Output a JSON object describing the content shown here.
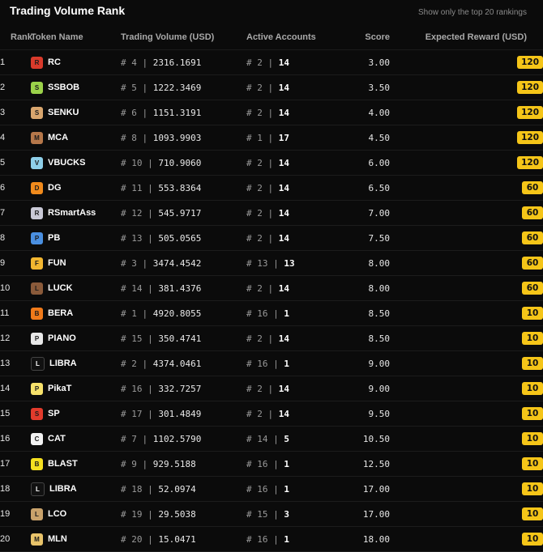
{
  "header": {
    "title": "Trading Volume Rank",
    "subtitle": "Show only the top 20 rankings"
  },
  "columns": {
    "rank": "Rank",
    "token": "Token Name",
    "volume": "Trading Volume (USD)",
    "accounts": "Active Accounts",
    "score": "Score",
    "reward": "Expected Reward (USD)"
  },
  "rows": [
    {
      "rank": "1",
      "token": "RC",
      "vol_rank": "4",
      "volume": "2316.1691",
      "acc_rank": "2",
      "accounts": "14",
      "score": "3.00",
      "reward": "120",
      "icon": "rc-icon",
      "icon_color": "#d93a2b",
      "icon_text": "R"
    },
    {
      "rank": "2",
      "token": "SSBOB",
      "vol_rank": "5",
      "volume": "1222.3469",
      "acc_rank": "2",
      "accounts": "14",
      "score": "3.50",
      "reward": "120",
      "icon": "ssbob-icon",
      "icon_color": "#9bd24a",
      "icon_text": "S"
    },
    {
      "rank": "3",
      "token": "SENKU",
      "vol_rank": "6",
      "volume": "1151.3191",
      "acc_rank": "2",
      "accounts": "14",
      "score": "4.00",
      "reward": "120",
      "icon": "senku-icon",
      "icon_color": "#d9a66e",
      "icon_text": "S"
    },
    {
      "rank": "4",
      "token": "MCA",
      "vol_rank": "8",
      "volume": "1093.9903",
      "acc_rank": "1",
      "accounts": "17",
      "score": "4.50",
      "reward": "120",
      "icon": "mca-icon",
      "icon_color": "#b5774a",
      "icon_text": "M"
    },
    {
      "rank": "5",
      "token": "VBUCKS",
      "vol_rank": "10",
      "volume": "710.9060",
      "acc_rank": "2",
      "accounts": "14",
      "score": "6.00",
      "reward": "120",
      "icon": "vbucks-icon",
      "icon_color": "#8fd0ea",
      "icon_text": "V"
    },
    {
      "rank": "6",
      "token": "DG",
      "vol_rank": "11",
      "volume": "553.8364",
      "acc_rank": "2",
      "accounts": "14",
      "score": "6.50",
      "reward": "60",
      "icon": "dg-icon",
      "icon_color": "#f08a1c",
      "icon_text": "D"
    },
    {
      "rank": "7",
      "token": "RSmartAss",
      "vol_rank": "12",
      "volume": "545.9717",
      "acc_rank": "2",
      "accounts": "14",
      "score": "7.00",
      "reward": "60",
      "icon": "rsmartass-icon",
      "icon_color": "#c9c9d6",
      "icon_text": "R"
    },
    {
      "rank": "8",
      "token": "PB",
      "vol_rank": "13",
      "volume": "505.0565",
      "acc_rank": "2",
      "accounts": "14",
      "score": "7.50",
      "reward": "60",
      "icon": "pb-icon",
      "icon_color": "#4a8fe0",
      "icon_text": "P"
    },
    {
      "rank": "9",
      "token": "FUN",
      "vol_rank": "3",
      "volume": "3474.4542",
      "acc_rank": "13",
      "accounts": "13",
      "score": "8.00",
      "reward": "60",
      "icon": "fun-icon",
      "icon_color": "#f2b630",
      "icon_text": "F"
    },
    {
      "rank": "10",
      "token": "LUCK",
      "vol_rank": "14",
      "volume": "381.4376",
      "acc_rank": "2",
      "accounts": "14",
      "score": "8.00",
      "reward": "60",
      "icon": "luck-icon",
      "icon_color": "#8a5a3a",
      "icon_text": "L"
    },
    {
      "rank": "11",
      "token": "BERA",
      "vol_rank": "1",
      "volume": "4920.8055",
      "acc_rank": "16",
      "accounts": "1",
      "score": "8.50",
      "reward": "10",
      "icon": "bera-icon",
      "icon_color": "#f07a1a",
      "icon_text": "B"
    },
    {
      "rank": "12",
      "token": "PIANO",
      "vol_rank": "15",
      "volume": "350.4741",
      "acc_rank": "2",
      "accounts": "14",
      "score": "8.50",
      "reward": "10",
      "icon": "piano-icon",
      "icon_color": "#e8e8e8",
      "icon_text": "P"
    },
    {
      "rank": "13",
      "token": "LIBRA",
      "vol_rank": "2",
      "volume": "4374.0461",
      "acc_rank": "16",
      "accounts": "1",
      "score": "9.00",
      "reward": "10",
      "icon": "libra-icon",
      "icon_color": "#111111",
      "icon_text": "L"
    },
    {
      "rank": "14",
      "token": "PikaT",
      "vol_rank": "16",
      "volume": "332.7257",
      "acc_rank": "2",
      "accounts": "14",
      "score": "9.00",
      "reward": "10",
      "icon": "pikat-icon",
      "icon_color": "#f7e26b",
      "icon_text": "P"
    },
    {
      "rank": "15",
      "token": "SP",
      "vol_rank": "17",
      "volume": "301.4849",
      "acc_rank": "2",
      "accounts": "14",
      "score": "9.50",
      "reward": "10",
      "icon": "sp-icon",
      "icon_color": "#e23b2c",
      "icon_text": "S"
    },
    {
      "rank": "16",
      "token": "CAT",
      "vol_rank": "7",
      "volume": "1102.5790",
      "acc_rank": "14",
      "accounts": "5",
      "score": "10.50",
      "reward": "10",
      "icon": "cat-icon",
      "icon_color": "#f2f2f2",
      "icon_text": "C"
    },
    {
      "rank": "17",
      "token": "BLAST",
      "vol_rank": "9",
      "volume": "929.5188",
      "acc_rank": "16",
      "accounts": "1",
      "score": "12.50",
      "reward": "10",
      "icon": "blast-icon",
      "icon_color": "#f5e020",
      "icon_text": "B"
    },
    {
      "rank": "18",
      "token": "LIBRA",
      "vol_rank": "18",
      "volume": "52.0974",
      "acc_rank": "16",
      "accounts": "1",
      "score": "17.00",
      "reward": "10",
      "icon": "libra-icon",
      "icon_color": "#111111",
      "icon_text": "L"
    },
    {
      "rank": "19",
      "token": "LCO",
      "vol_rank": "19",
      "volume": "29.5038",
      "acc_rank": "15",
      "accounts": "3",
      "score": "17.00",
      "reward": "10",
      "icon": "lco-icon",
      "icon_color": "#c9a26b",
      "icon_text": "L"
    },
    {
      "rank": "20",
      "token": "MLN",
      "vol_rank": "20",
      "volume": "15.0471",
      "acc_rank": "16",
      "accounts": "1",
      "score": "18.00",
      "reward": "10",
      "icon": "mln-icon",
      "icon_color": "#e8c36a",
      "icon_text": "M"
    }
  ],
  "colors": {
    "background": "#0b0b0b",
    "badge": "#f5c518",
    "divider": "#1c1c1c"
  }
}
